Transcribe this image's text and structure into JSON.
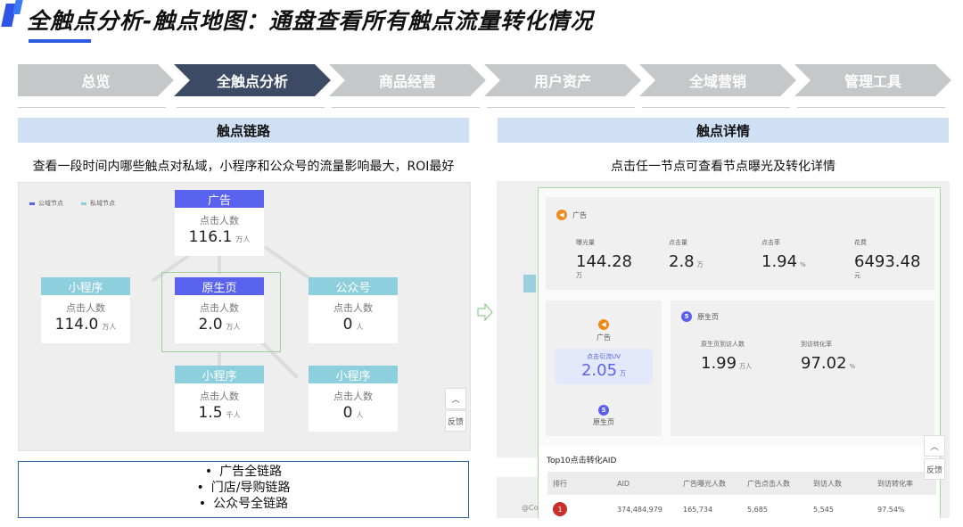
{
  "title": "全触点分析-触点地图：通盘查看所有触点流量转化情况",
  "nav": [
    "总览",
    "全触点分析",
    "商品经营",
    "用户资产",
    "全域营销",
    "管理工具"
  ],
  "nav_active": 1,
  "left": {
    "header": "触点链路",
    "desc": "查看一段时间内哪些触点对私域，小程序和公众号的流量影响最大，ROI最好",
    "legend": [
      "公域节点",
      "私域节点"
    ],
    "nodes": {
      "ad": {
        "name": "广告",
        "label": "点击人数",
        "value": "116.1",
        "unit": "万人"
      },
      "mini1": {
        "name": "小程序",
        "label": "点击人数",
        "value": "114.0",
        "unit": "万人"
      },
      "native": {
        "name": "原生页",
        "label": "点击人数",
        "value": "2.0",
        "unit": "万人"
      },
      "official": {
        "name": "公众号",
        "label": "点击人数",
        "value": "0",
        "unit": "人"
      },
      "mini2": {
        "name": "小程序",
        "label": "点击人数",
        "value": "1.5",
        "unit": "千人"
      },
      "mini3": {
        "name": "小程序",
        "label": "点击人数",
        "value": "0",
        "unit": "人"
      }
    },
    "feedback": "反馈",
    "bullets": [
      "广告全链路",
      "门店/导购链路",
      "公众号全链路"
    ]
  },
  "right": {
    "header": "触点详情",
    "desc": "点击任一节点可查看节点曝光及转化详情",
    "ad_card": {
      "name": "广告",
      "metrics": [
        {
          "label": "曝光量",
          "value": "144.28",
          "unit": "万"
        },
        {
          "label": "点击量",
          "value": "2.8",
          "unit": "万"
        },
        {
          "label": "点击率",
          "value": "1.94",
          "unit": "%"
        },
        {
          "label": "花费",
          "value": "6493.48",
          "unit": "元"
        }
      ]
    },
    "flow": {
      "top": "广告",
      "uv_label": "点击引流UV",
      "uv_value": "2.05",
      "uv_unit": "万",
      "bottom": "原生页"
    },
    "native_card": {
      "name": "原生页",
      "metrics": [
        {
          "label": "原生页到访人数",
          "value": "1.99",
          "unit": "万人"
        },
        {
          "label": "到访转化率",
          "value": "97.02",
          "unit": "%"
        }
      ]
    },
    "table": {
      "title": "Top10点击转化AID",
      "headers": [
        "排行",
        "AID",
        "广告曝光人数",
        "广告点击人数",
        "到访人数",
        "到访转化率"
      ],
      "rows": [
        [
          "1",
          "374,484,979",
          "165,734",
          "5,685",
          "5,545",
          "97.54%"
        ]
      ]
    },
    "feedback": "反馈",
    "footer_fragment": "@Co"
  }
}
